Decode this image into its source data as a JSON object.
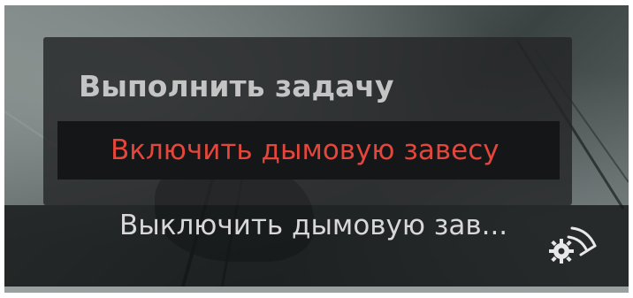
{
  "menu": {
    "title": "Выполнить задачу",
    "items": [
      {
        "label": "Включить дымовую завесу",
        "state": "highlighted"
      },
      {
        "label": "Выключить дымовую зав..."
      }
    ]
  },
  "icons": {
    "action": "gear-signal-icon"
  },
  "colors": {
    "highlight_text": "#e4463b",
    "normal_text": "#d8d8d8",
    "title_text": "#c4c4c4",
    "panel_bg": "#242627"
  }
}
